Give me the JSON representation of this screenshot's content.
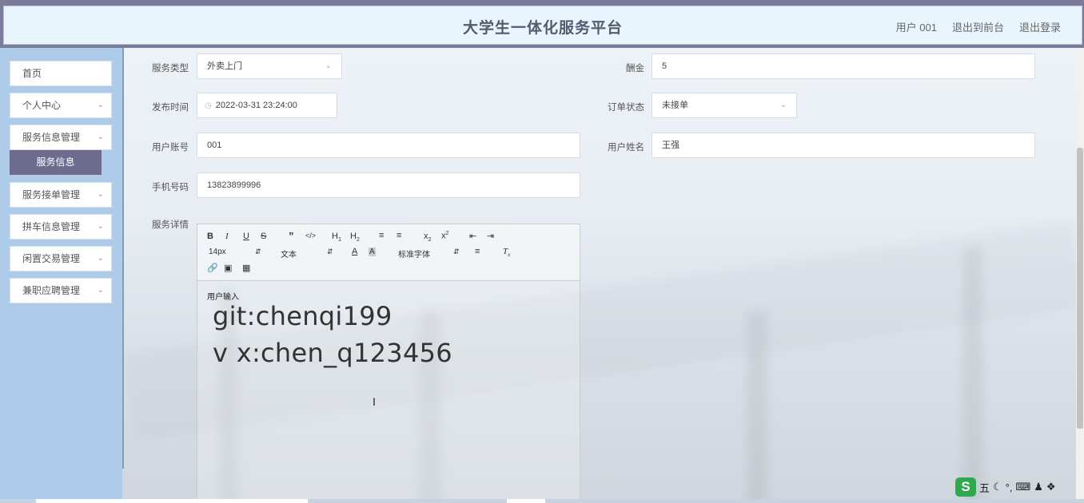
{
  "app": {
    "title": "大学生一体化服务平台",
    "user": "用户 001",
    "back_to_front": "退出到前台",
    "logout": "退出登录"
  },
  "sidebar": {
    "items": [
      {
        "label": "首页"
      },
      {
        "label": "个人中心"
      },
      {
        "label": "服务信息管理"
      },
      {
        "label": "服务接单管理"
      },
      {
        "label": "拼车信息管理"
      },
      {
        "label": "闲置交易管理"
      },
      {
        "label": "兼职应聘管理"
      }
    ],
    "active_sub": "服务信息"
  },
  "form": {
    "service_type": {
      "label": "服务类型",
      "value": "外卖上门"
    },
    "reward": {
      "label": "酬金",
      "value": "5"
    },
    "publish_time": {
      "label": "发布时间",
      "value": "2022-03-31 23:24:00"
    },
    "order_status": {
      "label": "订单状态",
      "value": "未接单"
    },
    "user_account": {
      "label": "用户账号",
      "value": "001"
    },
    "user_name": {
      "label": "用户姓名",
      "value": "王强"
    },
    "phone": {
      "label": "手机号码",
      "value": "13823899996"
    },
    "details": {
      "label": "服务详情"
    }
  },
  "editor": {
    "font_size": "14px",
    "paragraph": "文本",
    "font_family": "标准字体",
    "hint": "用户输入",
    "lines": [
      "git:chenqi199",
      "v x:chen_q123456"
    ]
  },
  "ime": {
    "mode": "五"
  }
}
